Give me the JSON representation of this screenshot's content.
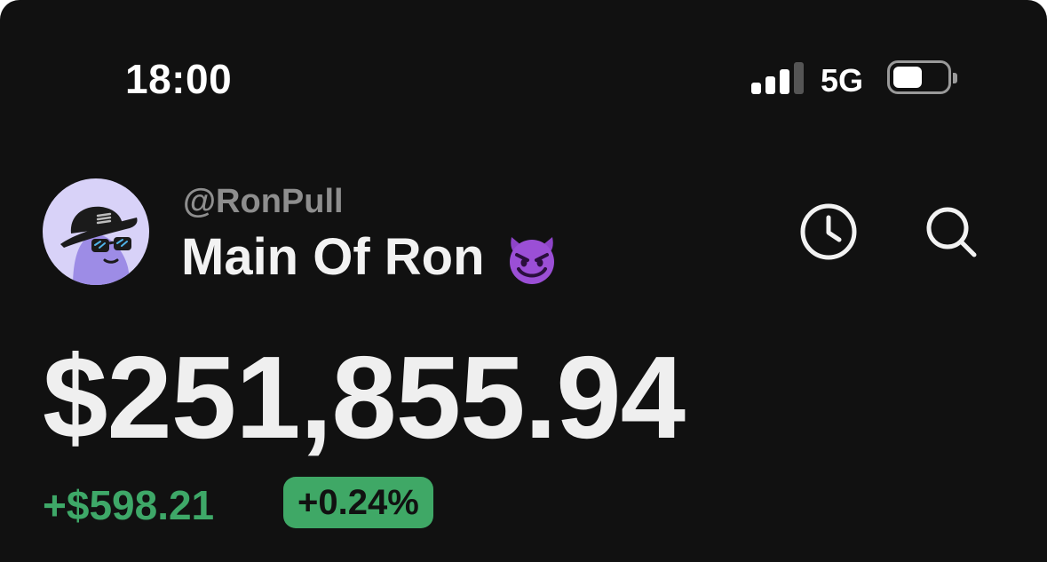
{
  "status_bar": {
    "time": "18:00",
    "network": "5G",
    "signal_level": 0.75,
    "battery_level": 0.5
  },
  "profile": {
    "username": "@RonPull",
    "account_name": "Main Of Ron",
    "emoji_icon": "smiling-devil-emoji",
    "avatar_icon": "cap-sunglasses-avatar-icon"
  },
  "actions": {
    "history_icon": "clock-icon",
    "search_icon": "search-icon"
  },
  "portfolio": {
    "balance": "$251,855.94",
    "change_amount": "+$598.21",
    "change_percent": "+0.24%"
  },
  "colors": {
    "background": "#111111",
    "positive": "#3ea868",
    "avatar_bg": "#d8d2f8"
  }
}
